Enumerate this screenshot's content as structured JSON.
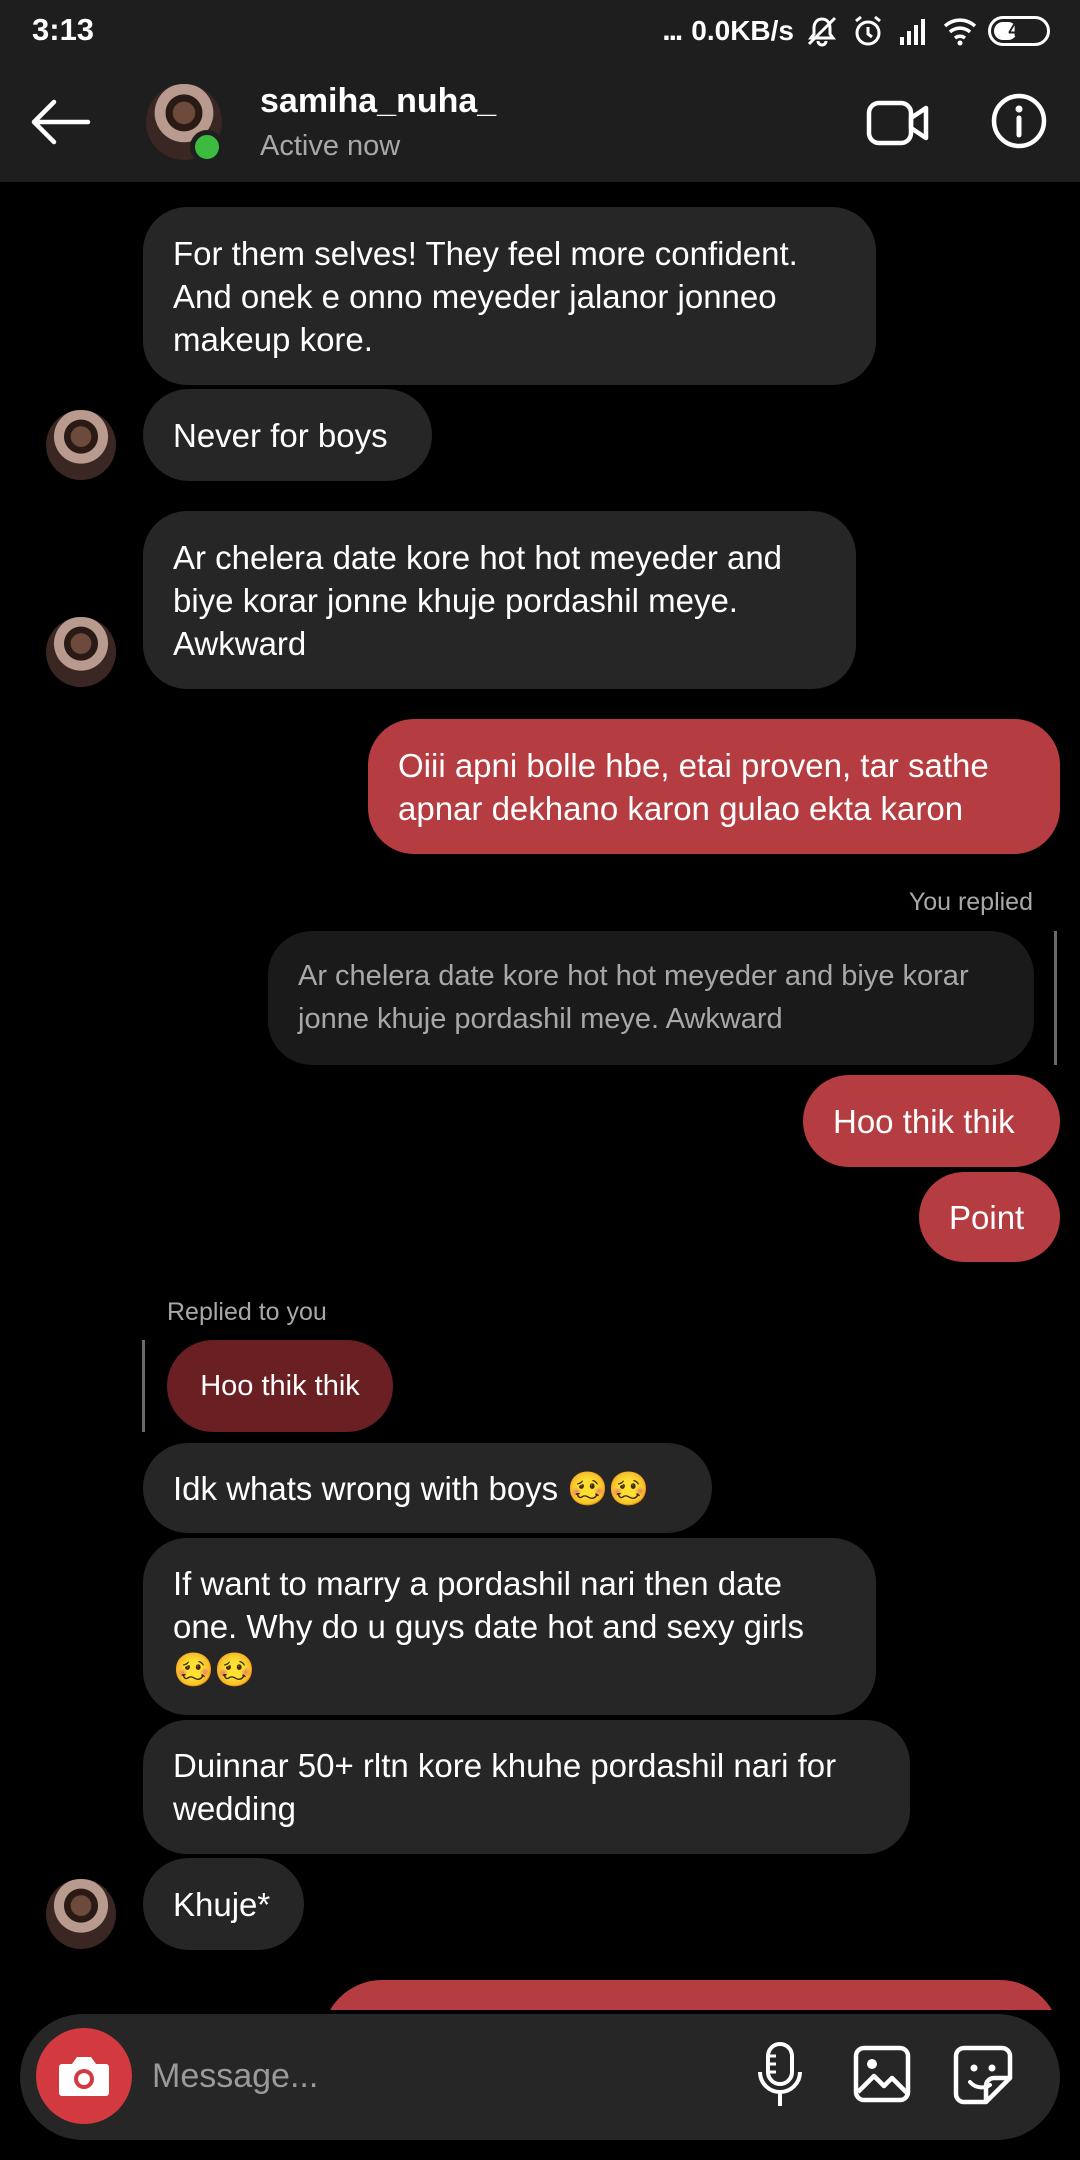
{
  "status_bar": {
    "time": "3:13",
    "dots": "...",
    "speed": "0.0KB/s",
    "battery": "45"
  },
  "header": {
    "username": "samiha_nuha_",
    "status": "Active now"
  },
  "messages": {
    "m1": "For them selves! They feel more confident.\nAnd onek e onno meyeder jalanor jonneo\nmakeup kore.",
    "m2": "Never for boys",
    "m3": "Ar chelera date kore hot hot meyeder and\nbiye korar jonne khuje pordashil meye.\nAwkward",
    "m4": "Oiii apni bolle hbe, etai proven, tar sathe\napnar dekhano karon gulao ekta karon",
    "you_replied_label": "You replied",
    "quoted": "Ar chelera date kore hot hot meyeder and biye korar\njonne khuje pordashil meye. Awkward",
    "m5": "Hoo thik thik",
    "m6": "Point",
    "replied_to_you_label": "Replied to you",
    "quoted_you": "Hoo thik thik",
    "m7": "Idk whats wrong with boys 🥴🥴",
    "m8": "If want to marry a pordashil nari then date\none. Why do u guys date hot and sexy girls\n🥴🥴",
    "m9": "Duinnar 50+ rltn kore khuhe pordashil nari for\nwedding",
    "m10": "Khuje*"
  },
  "composer": {
    "placeholder": "Message..."
  },
  "colors": {
    "outgoing_bubble": "#b53d41",
    "incoming_bubble": "#262626",
    "online": "#3dbb3f",
    "camera_button": "#d23a3f"
  },
  "icons": [
    "back-arrow-icon",
    "video-call-icon",
    "info-icon",
    "camera-icon",
    "microphone-icon",
    "gallery-icon",
    "sticker-icon",
    "mute-icon",
    "alarm-icon",
    "signal-icon",
    "wifi-icon",
    "battery-icon"
  ]
}
